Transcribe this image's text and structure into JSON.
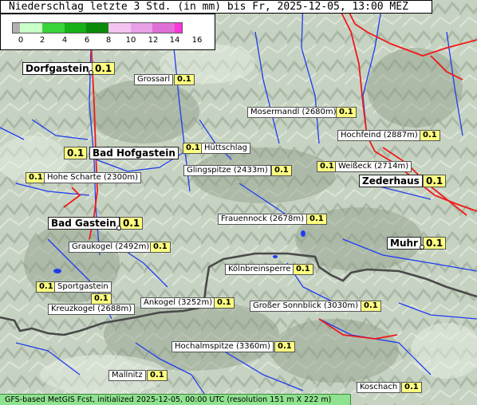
{
  "title": "Niederschlag letzte 3 Std. (in mm) bis Fr, 2025-12-05, 13:00 MEZ",
  "legend": {
    "ticks": [
      "0",
      "2",
      "4",
      "6",
      "8",
      "10",
      "12",
      "14",
      "16"
    ],
    "colors": [
      "#b0b0b0",
      "#c8ffc8",
      "#3ad33a",
      "#17b017",
      "#0a8a0a",
      "#f4c4f0",
      "#e8a0e6",
      "#e070d8",
      "#ff33dd"
    ]
  },
  "stations": [
    {
      "name": "Dorfgastein",
      "value": "0.1",
      "big": true
    },
    {
      "name": "Grossarl",
      "value": "0.1",
      "big": false
    },
    {
      "name": "Mosermandl (2680m)",
      "value": "0.1",
      "big": false
    },
    {
      "name": "Hochfeind (2887m)",
      "value": "0.1",
      "big": false
    },
    {
      "name": "Bad Hofgastein",
      "value": "0.1",
      "big": true
    },
    {
      "name": "Hüttschlag",
      "value": "0.1",
      "big": false
    },
    {
      "name": "Glingspitze (2433m)",
      "value": "0.1",
      "big": false
    },
    {
      "name": "Weißeck (2714m)",
      "value": "0.1",
      "big": false
    },
    {
      "name": "Hohe Scharte (2300m)",
      "value": "0.1",
      "big": false
    },
    {
      "name": "Zederhaus",
      "value": "0.1",
      "big": true
    },
    {
      "name": "Bad Gastein",
      "value": "0.1",
      "big": true
    },
    {
      "name": "Frauennock (2678m)",
      "value": "0.1",
      "big": false
    },
    {
      "name": "Muhr",
      "value": "0.1",
      "big": true
    },
    {
      "name": "Graukogel (2492m)",
      "value": "0.1",
      "big": false
    },
    {
      "name": "Kölnbreinsperre",
      "value": "0.1",
      "big": false
    },
    {
      "name": "Sportgastein",
      "value": "0.1",
      "big": false
    },
    {
      "name": "Kreuzkogel (2688m)",
      "value": "0.1",
      "big": false
    },
    {
      "name": "Ankogel (3252m)",
      "value": "0.1",
      "big": false
    },
    {
      "name": "Großer Sonnblick (3030m)",
      "value": "0.1",
      "big": false
    },
    {
      "name": "Hochalmspitze (3360m)",
      "value": "0.1",
      "big": false
    },
    {
      "name": "Mallnitz",
      "value": "0.1",
      "big": false
    },
    {
      "name": "Koschach",
      "value": "0.1",
      "big": false
    }
  ],
  "footer": "GFS-based MetGIS Fcst, initialized 2025-12-05, 00:00 UTC  (resolution 151 m X 222 m)"
}
